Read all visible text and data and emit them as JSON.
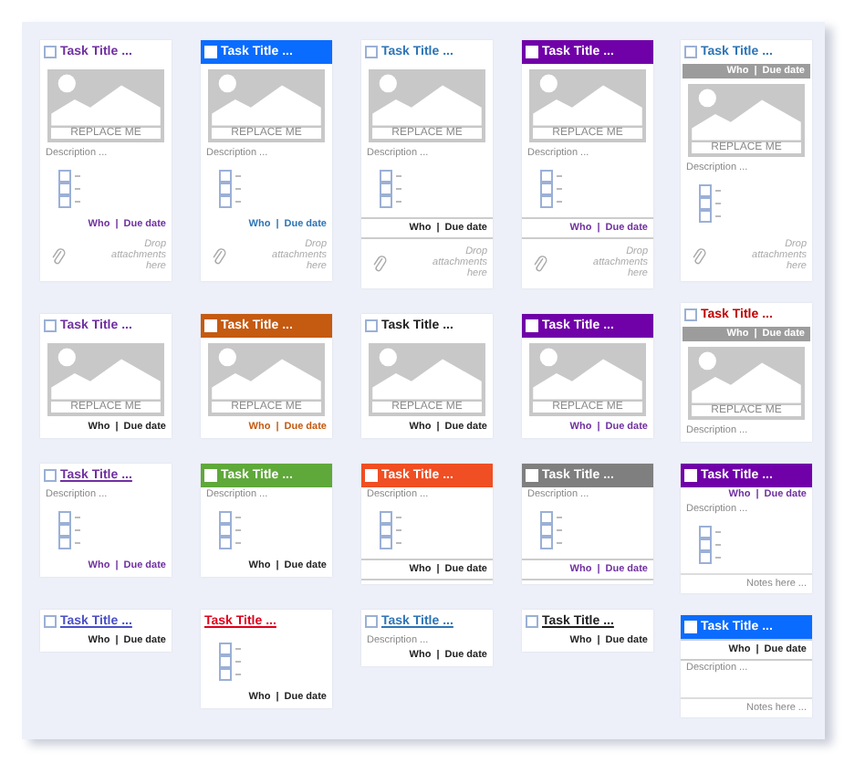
{
  "rows": [
    [
      {
        "kind": "plain",
        "title": "Task Title ...",
        "color": "#7030a0",
        "checkbox": {
          "checked": false
        },
        "underline": false,
        "image": "REPLACE ME",
        "description": "Description ...",
        "checklist": [
          {
            "checked": false
          },
          {
            "checked": false
          },
          {
            "checked": false
          }
        ],
        "footer_meta": {
          "kind": "plain",
          "who": "Who",
          "separator": "|",
          "due": "Due date",
          "color": "#7030a0"
        },
        "attachments": "Drop attachments here"
      },
      {
        "kind": "banner",
        "title": "Task Title ...",
        "color": "#0a6cff",
        "checkbox": {
          "checked": false
        },
        "underline": false,
        "image": "REPLACE ME",
        "description": "Description ...",
        "checklist": [
          {
            "checked": false
          },
          {
            "checked": false
          },
          {
            "checked": false
          }
        ],
        "footer_meta": {
          "kind": "plain",
          "who": "Who",
          "separator": "|",
          "due": "Due date",
          "color": "#2e75b6"
        },
        "attachments": "Drop attachments here"
      },
      {
        "kind": "plain",
        "title": "Task Title ...",
        "color": "#2e75b6",
        "checkbox": {
          "checked": false
        },
        "underline": false,
        "image": "REPLACE ME",
        "description": "Description ...",
        "checklist": [
          {
            "checked": false
          },
          {
            "checked": false
          },
          {
            "checked": false
          }
        ],
        "footer_meta": {
          "kind": "ruled",
          "who": "Who",
          "separator": "|",
          "due": "Due date",
          "color": "#222222"
        },
        "attachments": "Drop attachments here"
      },
      {
        "kind": "banner",
        "title": "Task Title ...",
        "color": "#7000a8",
        "checkbox": {
          "checked": false
        },
        "underline": false,
        "image": "REPLACE ME",
        "description": "Description ...",
        "checklist": [
          {
            "checked": false
          },
          {
            "checked": false
          },
          {
            "checked": false
          }
        ],
        "footer_meta": {
          "kind": "ruled",
          "who": "Who",
          "separator": "|",
          "due": "Due date",
          "color": "#7030a0"
        },
        "attachments": "Drop attachments here"
      }
    ],
    [
      {
        "kind": "plain",
        "title": "Task Title ...",
        "color": "#7030a0",
        "checkbox": {
          "checked": false
        },
        "underline": false,
        "image": "REPLACE ME",
        "footer_meta": {
          "kind": "plain",
          "who": "Who",
          "separator": "|",
          "due": "Due date",
          "color": "#222222"
        }
      },
      {
        "kind": "banner",
        "title": "Task Title ...",
        "color": "#c55a11",
        "checkbox": {
          "checked": false
        },
        "underline": false,
        "image": "REPLACE ME",
        "footer_meta": {
          "kind": "plain",
          "who": "Who",
          "separator": "|",
          "due": "Due date",
          "color": "#c55a11"
        }
      },
      {
        "kind": "plain",
        "title": "Task Title ...",
        "color": "#222222",
        "checkbox": {
          "checked": false
        },
        "underline": false,
        "image": "REPLACE ME",
        "footer_meta": {
          "kind": "plain",
          "who": "Who",
          "separator": "|",
          "due": "Due date",
          "color": "#222222"
        }
      },
      {
        "kind": "banner",
        "title": "Task Title ...",
        "color": "#7000a8",
        "checkbox": {
          "checked": false
        },
        "underline": false,
        "image": "REPLACE ME",
        "footer_meta": {
          "kind": "plain",
          "who": "Who",
          "separator": "|",
          "due": "Due date",
          "color": "#7030a0"
        }
      }
    ],
    [
      {
        "kind": "plain",
        "title": "Task Title ...",
        "color": "#7030a0",
        "checkbox": {
          "checked": false
        },
        "underline": true,
        "description": "Description ...",
        "checklist": [
          {
            "checked": false
          },
          {
            "checked": false
          },
          {
            "checked": false
          }
        ],
        "footer_meta": {
          "kind": "plain",
          "who": "Who",
          "separator": "|",
          "due": "Due date",
          "color": "#7030a0"
        }
      },
      {
        "kind": "banner",
        "title": "Task Title ...",
        "color": "#5fa83a",
        "checkbox": {
          "checked": false
        },
        "underline": false,
        "description": "Description ...",
        "checklist": [
          {
            "checked": false
          },
          {
            "checked": false
          },
          {
            "checked": false
          }
        ],
        "footer_meta": {
          "kind": "plain",
          "who": "Who",
          "separator": "|",
          "due": "Due date",
          "color": "#222222"
        }
      },
      {
        "kind": "banner",
        "title": "Task Title ...",
        "color": "#f04e23",
        "checkbox": {
          "checked": false
        },
        "underline": false,
        "description": "Description ...",
        "checklist": [
          {
            "checked": false
          },
          {
            "checked": false
          },
          {
            "checked": false
          }
        ],
        "footer_meta": {
          "kind": "ruled",
          "who": "Who",
          "separator": "|",
          "due": "Due date",
          "color": "#222222"
        }
      },
      {
        "kind": "banner",
        "title": "Task Title ...",
        "color": "#7f7f7f",
        "checkbox": {
          "checked": false
        },
        "underline": false,
        "description": "Description ...",
        "checklist": [
          {
            "checked": false
          },
          {
            "checked": false
          },
          {
            "checked": false
          }
        ],
        "footer_meta": {
          "kind": "ruled",
          "who": "Who",
          "separator": "|",
          "due": "Due date",
          "color": "#7030a0"
        }
      }
    ],
    [
      {
        "kind": "plain",
        "title": "Task Title ...",
        "color": "#4a4fc8",
        "checkbox": {
          "checked": false
        },
        "underline": true,
        "footer_meta": {
          "kind": "plain",
          "who": "Who",
          "separator": "|",
          "due": "Due date",
          "color": "#222222"
        }
      },
      {
        "kind": "plain",
        "title": "Task Title ...",
        "color": "#e0001b",
        "underline": true,
        "checklist": [
          {
            "checked": false
          },
          {
            "checked": false
          },
          {
            "checked": false
          }
        ],
        "footer_meta": {
          "kind": "plain",
          "who": "Who",
          "separator": "|",
          "due": "Due date",
          "color": "#222222"
        }
      },
      {
        "kind": "plain",
        "title": "Task Title ...",
        "color": "#2e75b6",
        "checkbox": {
          "checked": false
        },
        "underline": true,
        "description": "Description ...",
        "footer_meta": {
          "kind": "plain",
          "who": "Who",
          "separator": "|",
          "due": "Due date",
          "color": "#222222"
        }
      },
      {
        "kind": "plain",
        "title": "Task Title ...",
        "color": "#222222",
        "checkbox": {
          "checked": false
        },
        "underline": true,
        "footer_meta": {
          "kind": "plain",
          "who": "Who",
          "separator": "|",
          "due": "Due date",
          "color": "#222222"
        }
      }
    ]
  ],
  "side_column": [
    {
      "kind": "plain",
      "title": "Task Title ...",
      "color": "#2e75b6",
      "checkbox": {
        "checked": false
      },
      "underline": false,
      "header_meta": {
        "kind": "bar",
        "who": "Who",
        "separator": "|",
        "due": "Due date",
        "color": "#ffffff"
      },
      "image": "REPLACE ME",
      "description": "Description ...",
      "checklist": [
        {
          "checked": false
        },
        {
          "checked": false
        },
        {
          "checked": false
        }
      ],
      "attachments": "Drop attachments here"
    },
    {
      "kind": "plain",
      "title": "Task Title ...",
      "color": "#c00000",
      "checkbox": {
        "checked": false
      },
      "underline": false,
      "header_meta": {
        "kind": "bar",
        "who": "Who",
        "separator": "|",
        "due": "Due date",
        "color": "#ffffff"
      },
      "image": "REPLACE ME",
      "description": "Description ..."
    },
    {
      "kind": "banner",
      "title": "Task Title ...",
      "color": "#7000a8",
      "checkbox": {
        "checked": false
      },
      "underline": false,
      "header_meta": {
        "kind": "plain",
        "who": "Who",
        "separator": "|",
        "due": "Due date",
        "color": "#7030a0"
      },
      "description": "Description ...",
      "checklist": [
        {
          "checked": false
        },
        {
          "checked": false
        },
        {
          "checked": false
        }
      ],
      "notes": "Notes here ..."
    },
    {
      "kind": "banner",
      "title": "Task Title ...",
      "color": "#0a6cff",
      "checkbox": {
        "checked": false
      },
      "underline": false,
      "header_meta": {
        "kind": "ruled",
        "who": "Who",
        "separator": "|",
        "due": "Due date",
        "color": "#222222"
      },
      "description": "Description ...",
      "notes": "Notes here ..."
    }
  ]
}
